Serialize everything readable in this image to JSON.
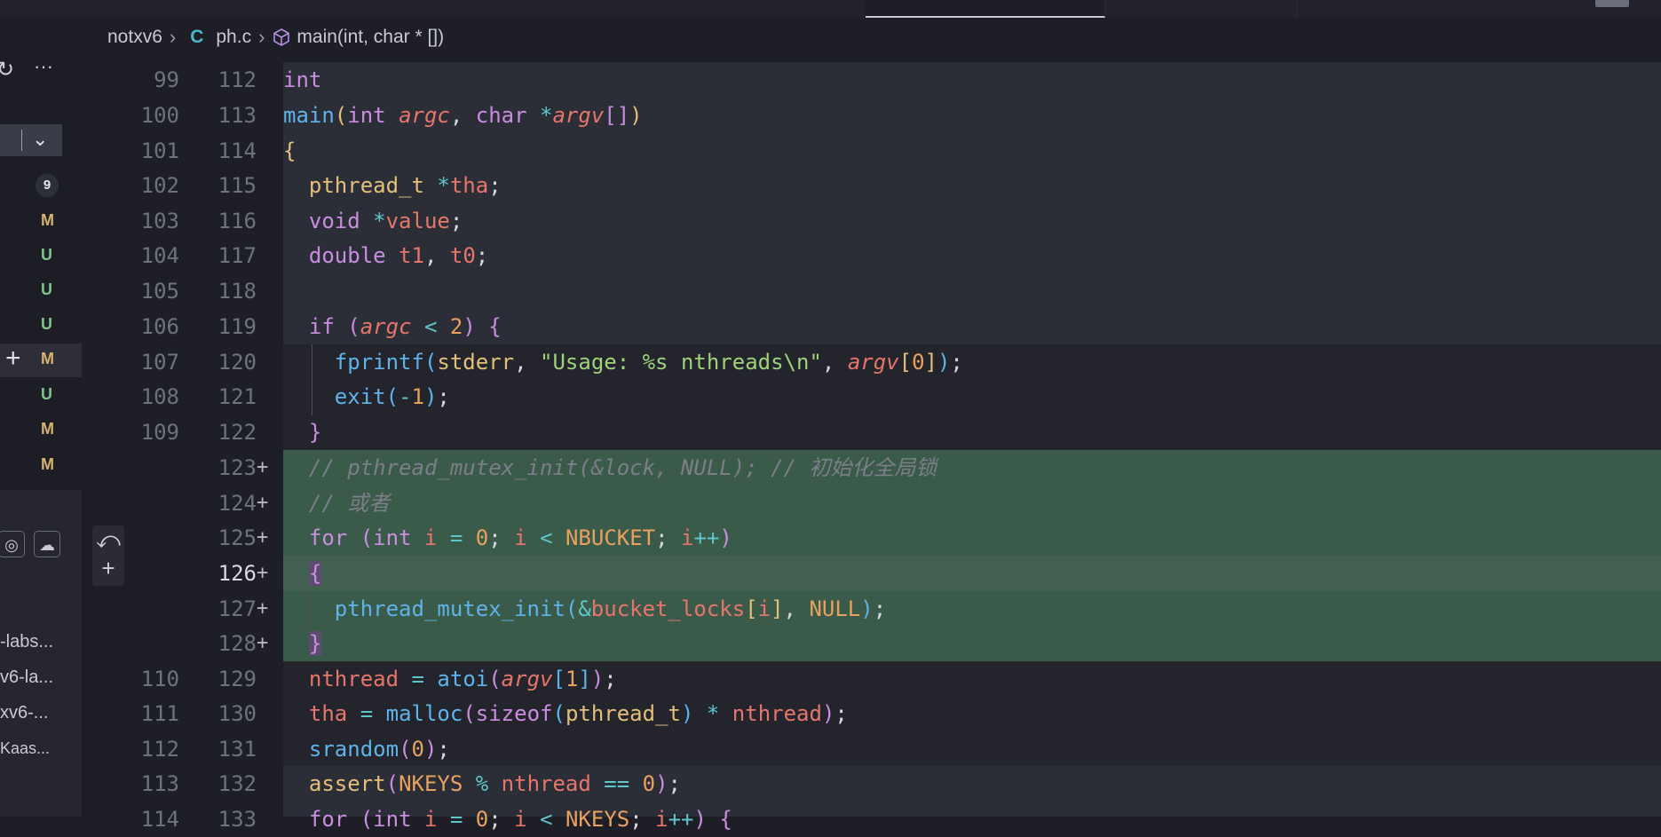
{
  "breadcrumb": {
    "folder": "notxv6",
    "file_type_icon": "C",
    "file": "ph.c",
    "symbol": "main(int, char * [])"
  },
  "sidebar": {
    "more": "···",
    "badge_count": "9",
    "statuses": [
      "M",
      "U",
      "U",
      "U",
      "M",
      "U",
      "M",
      "M"
    ],
    "repos": [
      "-labs...",
      "v6-la...",
      "xv6-...",
      "Kaas..."
    ]
  },
  "gutter": {
    "old_numbers": [
      "99",
      "100",
      "101",
      "102",
      "103",
      "104",
      "105",
      "106",
      "107",
      "108",
      "109",
      "",
      "",
      "",
      "",
      "",
      "",
      "110",
      "111",
      "112",
      "113",
      "114"
    ],
    "new_numbers": [
      "112",
      "113",
      "114",
      "115",
      "116",
      "117",
      "118",
      "119",
      "120",
      "121",
      "122",
      "123",
      "124",
      "125",
      "126",
      "127",
      "128",
      "129",
      "130",
      "131",
      "132",
      "133"
    ],
    "added_marker": "+"
  },
  "code": {
    "comment_1": "// pthread_mutex_init(&lock, NULL); // 初始化全局锁",
    "comment_2": "// 或者",
    "usage_string": "\"Usage: %s nthreads\\n\""
  }
}
